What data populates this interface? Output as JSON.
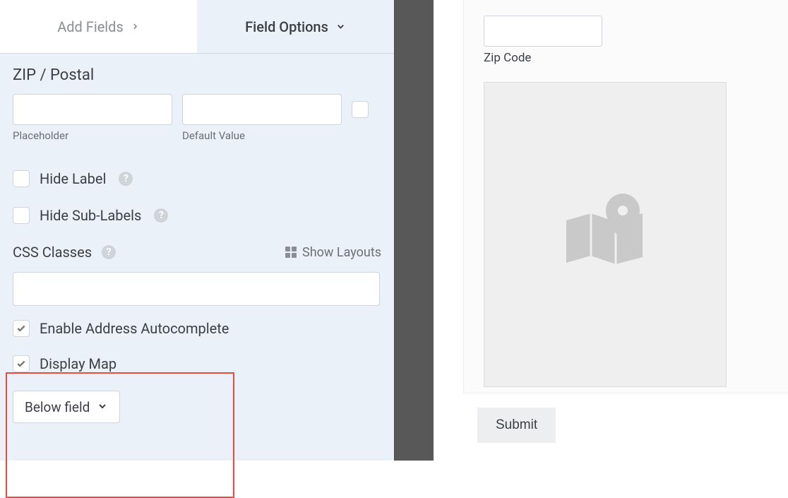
{
  "tabs": {
    "add_fields": "Add Fields",
    "field_options": "Field Options"
  },
  "section": {
    "zip_postal": "ZIP / Postal"
  },
  "pdv": {
    "placeholder_label": "Placeholder",
    "default_value_label": "Default Value"
  },
  "checks": {
    "hide_label": "Hide Label",
    "hide_sublabels": "Hide Sub-Labels"
  },
  "css": {
    "label": "CSS Classes",
    "show_layouts": "Show Layouts"
  },
  "autocomplete": {
    "enable": "Enable Address Autocomplete",
    "display_map": "Display Map",
    "position": "Below field"
  },
  "preview": {
    "zip_label": "Zip Code",
    "submit": "Submit"
  }
}
